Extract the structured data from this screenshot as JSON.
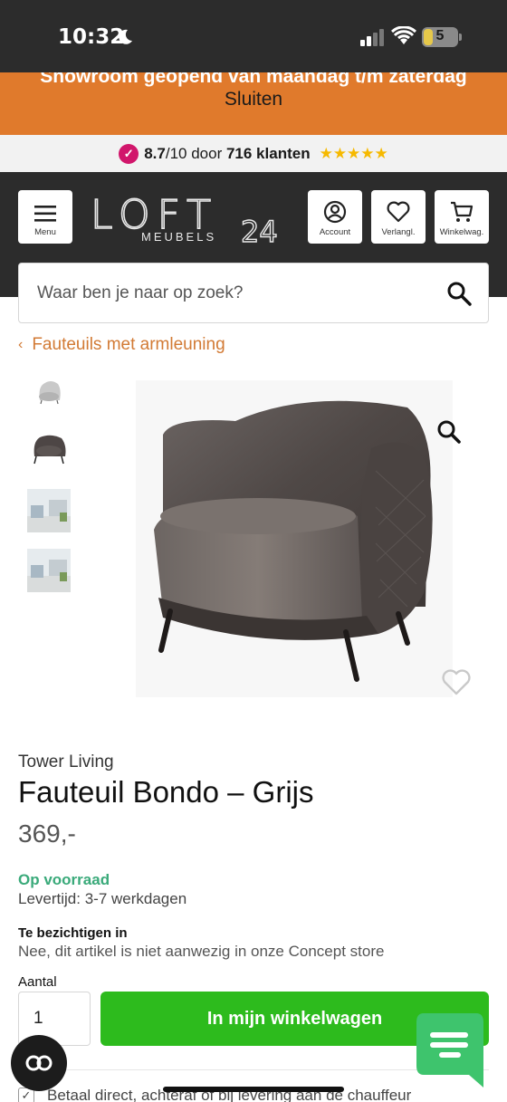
{
  "status_bar": {
    "time": "10:32",
    "battery": "5"
  },
  "promo": {
    "text": "Showroom geopend van maandag t/m zaterdag",
    "close_label": "Sluiten"
  },
  "rating": {
    "score": "8.7",
    "scale": "/10 door ",
    "count": "716 klanten",
    "stars": "★★★★★",
    "colors": {
      "logo": "#d1166b",
      "stars": "#f6b900"
    }
  },
  "header": {
    "menu_label": "Menu",
    "account_label": "Account",
    "wishlist_label": "Verlangl.",
    "cart_label": "Winkelwag.",
    "logo_word": "LOFT",
    "logo_sub": "MEUBELS",
    "logo_num": "24"
  },
  "search": {
    "placeholder": "Waar ben je naar op zoek?"
  },
  "breadcrumb": {
    "label": "Fauteuils met armleuning"
  },
  "product": {
    "brand": "Tower Living",
    "title": "Fauteuil Bondo – Grijs",
    "price": "369,-",
    "stock": "Op voorraad",
    "lead_time": "Levertijd: 3-7 werkdagen",
    "view_label": "Te bezichtigen in",
    "view_value": "Nee, dit artikel is niet aanwezig in onze Concept store",
    "qty_label": "Aantal",
    "qty_value": "1",
    "cart_button": "In mijn winkelwagen",
    "pay_note": "Betaal direct, achteraf of bij levering aan de chauffeur"
  },
  "colors": {
    "accent": "#e07a2c",
    "header_bg": "#2c2c2c",
    "cart_green": "#2dbb1d",
    "stock_green": "#3aaa7a",
    "link": "#d27a34",
    "chat_green": "#3ec46d"
  },
  "icons": [
    "moon-icon",
    "signal-icon",
    "wifi-icon",
    "battery-icon",
    "menu-icon",
    "account-icon",
    "heart-icon",
    "cart-icon",
    "search-icon",
    "chevron-left-icon",
    "zoom-icon",
    "wishlist-heart-icon",
    "cookie-icon",
    "chat-icon",
    "check-icon"
  ]
}
